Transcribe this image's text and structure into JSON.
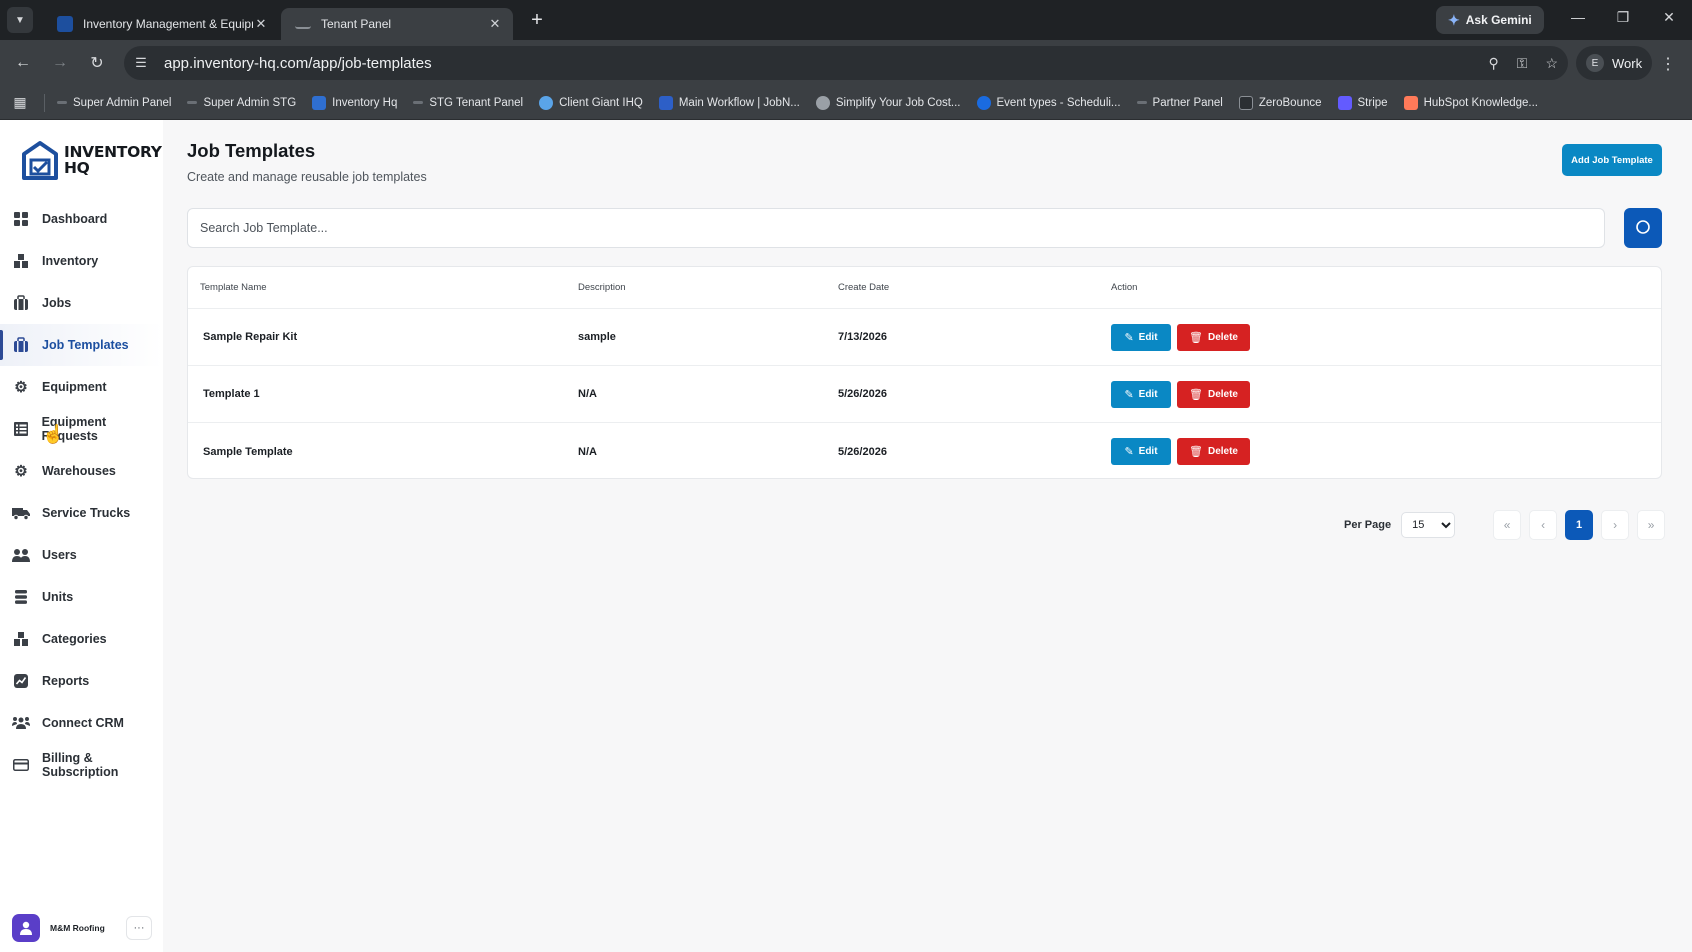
{
  "browser": {
    "tabs": [
      {
        "title": "Inventory Management & Equipm",
        "active": false
      },
      {
        "title": "Tenant Panel",
        "active": true
      }
    ],
    "ask_gemini": "Ask Gemini",
    "url": "app.inventory-hq.com/app/job-templates",
    "profile_initial": "E",
    "profile_name": "Work",
    "bookmarks": [
      "Super Admin Panel",
      "Super Admin STG",
      "Inventory Hq",
      "STG Tenant Panel",
      "Client Giant IHQ",
      "Main Workflow | JobN...",
      "Simplify Your Job Cost...",
      "Event types - Scheduli...",
      "Partner Panel",
      "ZeroBounce",
      "Stripe",
      "HubSpot Knowledge..."
    ]
  },
  "logo": {
    "line1": "INVENTORY",
    "line2": "HQ"
  },
  "sidebar": {
    "items": [
      {
        "label": "Dashboard",
        "icon": "grid-icon",
        "active": false
      },
      {
        "label": "Inventory",
        "icon": "boxes-icon",
        "active": false
      },
      {
        "label": "Jobs",
        "icon": "briefcase-icon",
        "active": false
      },
      {
        "label": "Job Templates",
        "icon": "briefcase-icon",
        "active": true
      },
      {
        "label": "Equipment",
        "icon": "wrench-gear-icon",
        "active": false
      },
      {
        "label": "Equipment Requests",
        "icon": "list-icon",
        "active": false
      },
      {
        "label": "Warehouses",
        "icon": "warehouse-gear-icon",
        "active": false
      },
      {
        "label": "Service Trucks",
        "icon": "truck-icon",
        "active": false
      },
      {
        "label": "Users",
        "icon": "users-icon",
        "active": false
      },
      {
        "label": "Units",
        "icon": "stack-icon",
        "active": false
      },
      {
        "label": "Categories",
        "icon": "boxes-icon",
        "active": false
      },
      {
        "label": "Reports",
        "icon": "chart-icon",
        "active": false
      },
      {
        "label": "Connect CRM",
        "icon": "network-icon",
        "active": false
      },
      {
        "label": "Billing & Subscription",
        "icon": "card-icon",
        "active": false
      }
    ],
    "user_name": "M&M Roofing",
    "more_label": "···"
  },
  "page": {
    "title": "Job Templates",
    "subtitle": "Create and manage reusable job templates",
    "add_button": "Add Job Template",
    "search_placeholder": "Search Job Template..."
  },
  "table": {
    "headers": [
      "Template Name",
      "Description",
      "Create Date",
      "Action"
    ],
    "rows": [
      {
        "name": "Sample Repair Kit",
        "description": "sample",
        "date": "7/13/2026"
      },
      {
        "name": "Template 1",
        "description": "N/A",
        "date": "5/26/2026"
      },
      {
        "name": "Sample Template",
        "description": "N/A",
        "date": "5/26/2026"
      }
    ],
    "edit_label": "Edit",
    "delete_label": "Delete"
  },
  "pagination": {
    "per_page_label": "Per Page",
    "per_page_value": "15",
    "first": "«",
    "prev": "‹",
    "current_page": "1",
    "next": "›",
    "last": "»"
  },
  "colors": {
    "primary_blue": "#0c59b8",
    "edit_blue": "#0a88c4",
    "delete_red": "#d62222",
    "active_nav": "#1c4fa0"
  }
}
